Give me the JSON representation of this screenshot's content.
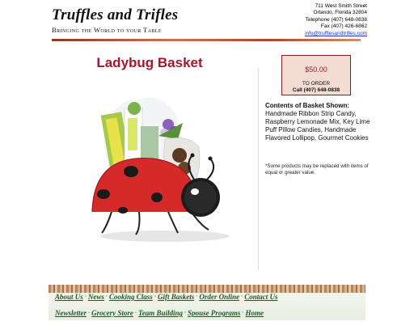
{
  "header": {
    "logo_title": "Truffles and Trifles",
    "logo_tagline": "Bringing the World to your Table",
    "address": [
      "711 West Smith Street",
      "Orlando, Florida 32804",
      "Telephone (407) 648-0838",
      "Fax (407) 426-6862"
    ],
    "email": "info@trufflesandtrifles.com"
  },
  "product": {
    "title": "Ladybug Basket",
    "price": "$50.00",
    "to_order": "TO ORDER",
    "call": "Call (407) 648-0838",
    "contents_heading": "Contents of Basket Shown:",
    "contents_text": "Handmade Ribbon Strip Candy, Raspberry Lemonade Mix, Key Lime Puff Pillow Candies, Handmade Flavored Lollipop, Gourmet Cookies",
    "disclaimer": "*Some products may be replaced with items of equal or greater value."
  },
  "footer": {
    "nav_row1": [
      "About Us",
      "News",
      "Cooking Class",
      "Gift Baskets",
      "Order Online",
      "Contact Us"
    ],
    "nav_row2": [
      "Newsletter",
      "Grocery Store",
      "Team Building",
      "Spouse Programs",
      "Home"
    ]
  },
  "colors": {
    "title": "#a3182b",
    "price_box_bg": "#f3dcd4",
    "nav_text": "#1d5b24",
    "link": "#1a33c8"
  },
  "icons": {
    "product_image": "ladybug-basket-image"
  }
}
